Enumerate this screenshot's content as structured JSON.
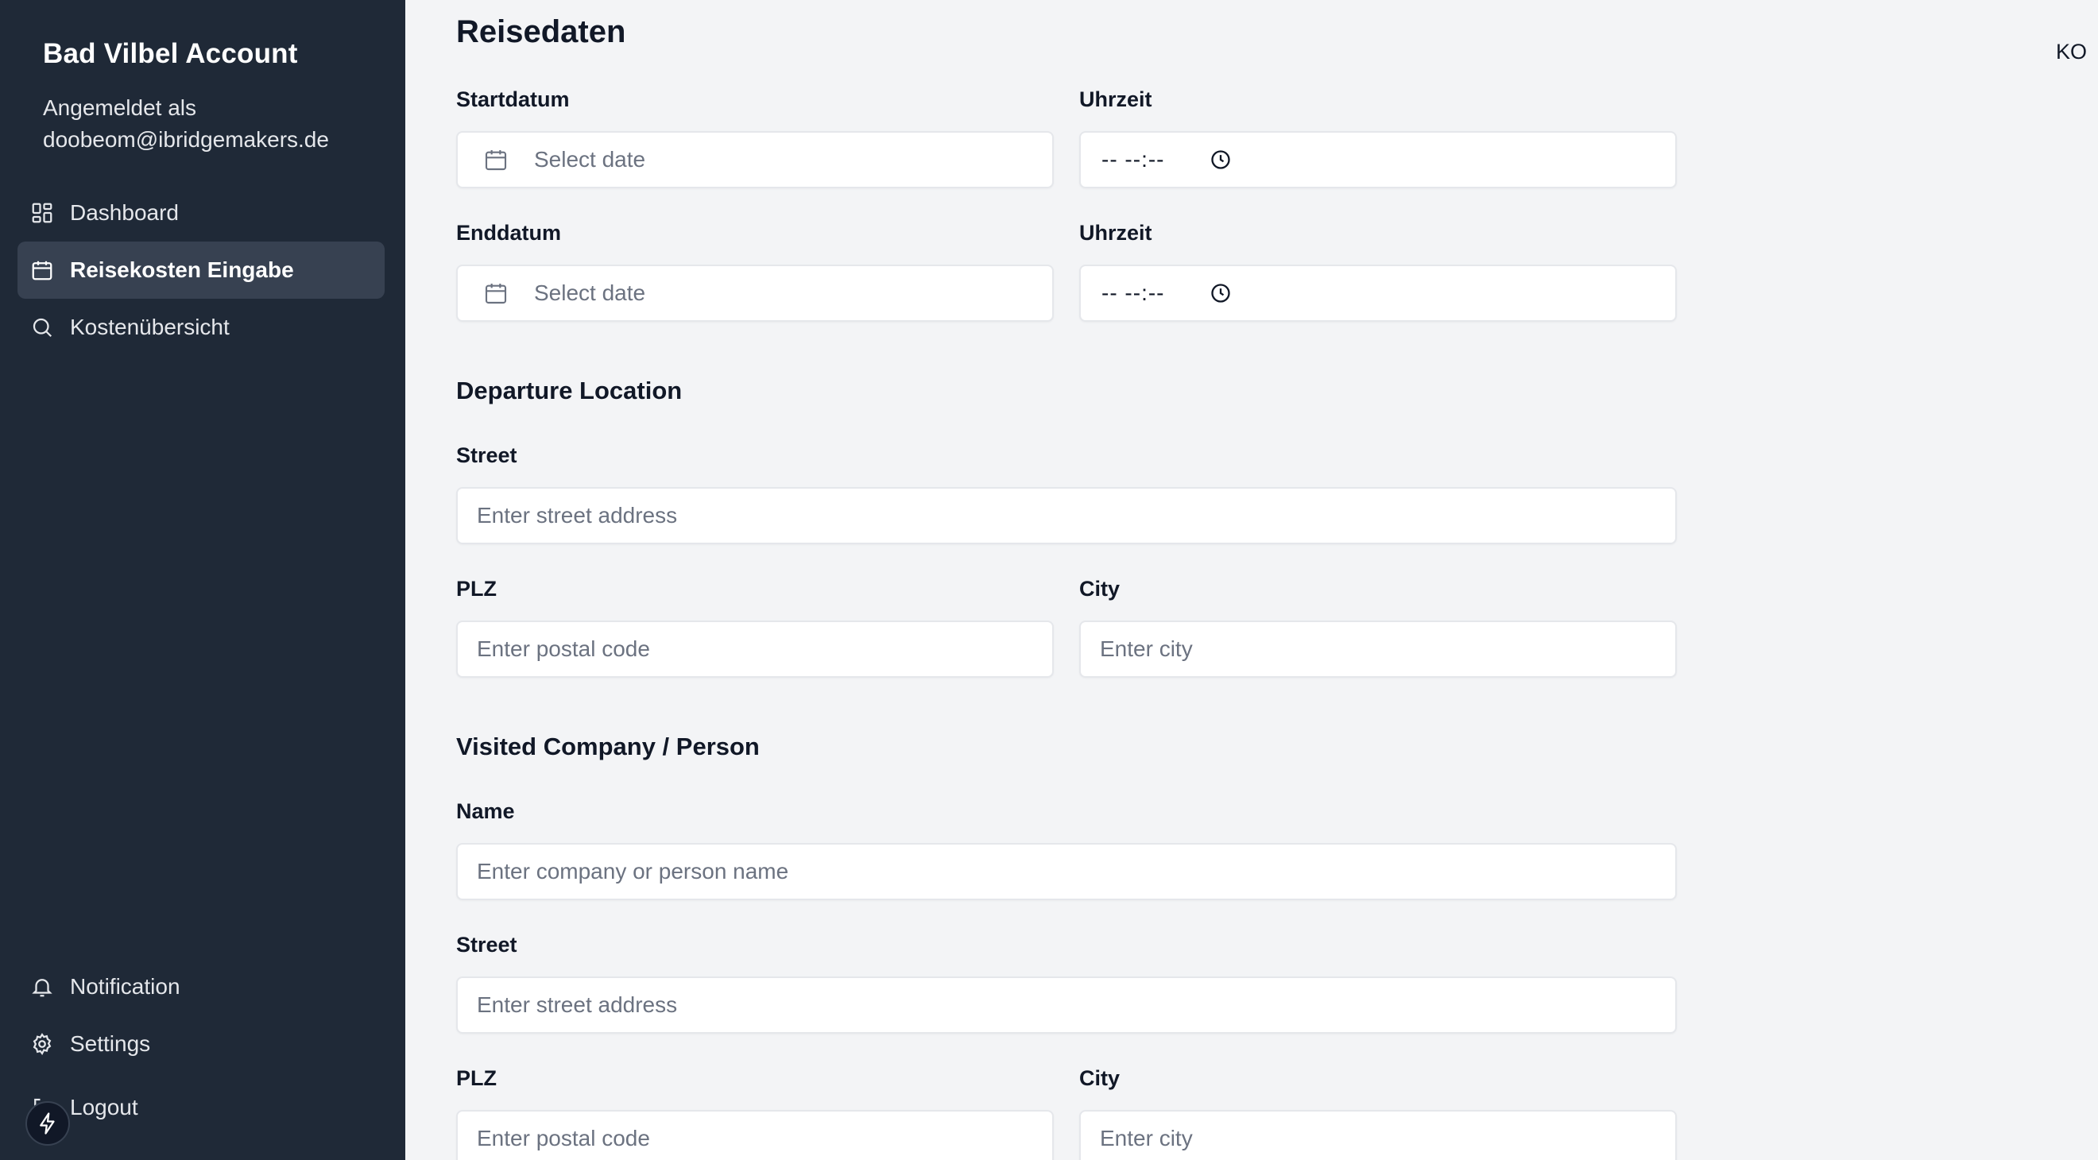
{
  "sidebar": {
    "brand": "Bad Vilbel Account",
    "login_prefix": "Angemeldet als",
    "login_email": "doobeom@ibridgemakers.de",
    "nav": [
      {
        "label": "Dashboard",
        "icon": "dashboard-grid-icon",
        "active": false
      },
      {
        "label": "Reisekosten Eingabe",
        "icon": "calendar-icon",
        "active": true
      },
      {
        "label": "Kostenübersicht",
        "icon": "search-icon",
        "active": false
      }
    ],
    "bottom_nav": [
      {
        "label": "Notification",
        "icon": "bell-icon"
      },
      {
        "label": "Settings",
        "icon": "gear-icon"
      },
      {
        "label": "Logout",
        "icon": "logout-icon"
      }
    ],
    "fab_icon": "lightning-icon"
  },
  "header": {
    "user_initials": "KO"
  },
  "form": {
    "title": "Reisedaten",
    "start_date": {
      "label": "Startdatum",
      "placeholder": "Select date"
    },
    "start_time": {
      "label": "Uhrzeit",
      "value": "-- --:--"
    },
    "end_date": {
      "label": "Enddatum",
      "placeholder": "Select date"
    },
    "end_time": {
      "label": "Uhrzeit",
      "value": "-- --:--"
    },
    "departure": {
      "title": "Departure Location",
      "street": {
        "label": "Street",
        "placeholder": "Enter street address"
      },
      "plz": {
        "label": "PLZ",
        "placeholder": "Enter postal code"
      },
      "city": {
        "label": "City",
        "placeholder": "Enter city"
      }
    },
    "visited": {
      "title": "Visited Company / Person",
      "name": {
        "label": "Name",
        "placeholder": "Enter company or person name"
      },
      "street": {
        "label": "Street",
        "placeholder": "Enter street address"
      },
      "plz": {
        "label": "PLZ",
        "placeholder": "Enter postal code"
      },
      "city": {
        "label": "City",
        "placeholder": "Enter city"
      }
    }
  }
}
